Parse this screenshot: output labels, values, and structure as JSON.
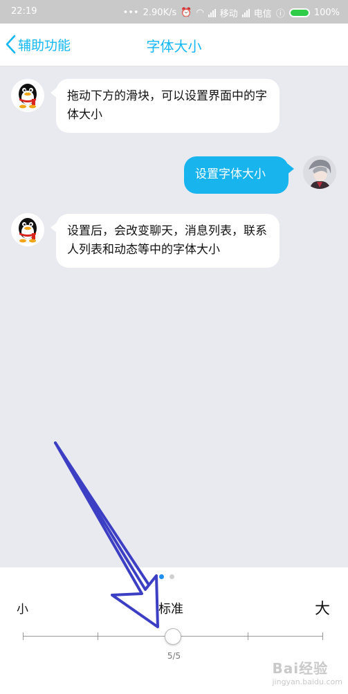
{
  "status_bar": {
    "time": "22:19",
    "speed": "2.90K/s",
    "carrier1": "移动",
    "carrier2": "电信",
    "battery": "100%"
  },
  "header": {
    "back_label": "辅助功能",
    "title": "字体大小"
  },
  "messages": [
    {
      "side": "left",
      "text": "拖动下方的滑块，可以设置界面中的字体大小"
    },
    {
      "side": "right",
      "text": "设置字体大小"
    },
    {
      "side": "left",
      "text": "设置后，会改变聊天，消息列表，联系人列表和动态等中的字体大小"
    }
  ],
  "font_size": {
    "labels": {
      "small": "小",
      "standard": "标准",
      "large": "大"
    },
    "level_text": "5/5",
    "page_dots": 2,
    "active_dot": 0
  },
  "watermark": {
    "text": "Bai经验",
    "sub": "jingyan.baidu.com"
  }
}
